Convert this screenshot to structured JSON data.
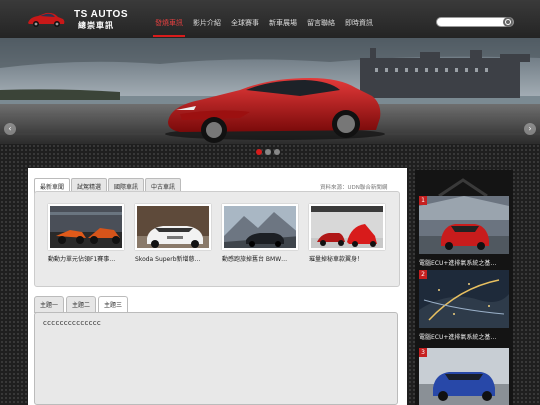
{
  "brand": {
    "name_en": "TS AUTOS",
    "name_zh": "總崇車訊"
  },
  "nav": [
    {
      "label": "發燒車訊",
      "active": true
    },
    {
      "label": "影片介紹",
      "active": false
    },
    {
      "label": "全球賽事",
      "active": false
    },
    {
      "label": "新車展場",
      "active": false
    },
    {
      "label": "留言聯絡",
      "active": false
    },
    {
      "label": "即時資訊",
      "active": false
    }
  ],
  "search": {
    "placeholder": ""
  },
  "banner": {
    "slides": 3,
    "active_slide": 1
  },
  "news_tabs": [
    {
      "label": "最新車聞",
      "active": true
    },
    {
      "label": "試駕精選",
      "active": false
    },
    {
      "label": "國際車訊",
      "active": false
    },
    {
      "label": "中古車訊",
      "active": false
    }
  ],
  "news_source": "資料來源：UDN聯合新聞網",
  "news_items": [
    {
      "caption": "動動力單元佔領F1賽事…"
    },
    {
      "caption": "Skoda Superb新增慈…"
    },
    {
      "caption": "動感跑旅掉舊台 BMW…"
    },
    {
      "caption": "璀量掉秘車款翼身！"
    }
  ],
  "topic_tabs": [
    {
      "label": "主題一",
      "active": false
    },
    {
      "label": "主題二",
      "active": false
    },
    {
      "label": "主題三",
      "active": true
    }
  ],
  "topic_content": "cccccccccccccc",
  "sidebar_items": [
    {
      "num": "1",
      "caption": "電腦ECU+進排氣系統之基…"
    },
    {
      "num": "2",
      "caption": "電腦ECU+進排氣系統之基…"
    },
    {
      "num": "3",
      "caption": ""
    }
  ],
  "colors": {
    "accent": "#d81b1b",
    "header_bg": "#2e2e2e",
    "panel_bg": "#ffffff"
  }
}
